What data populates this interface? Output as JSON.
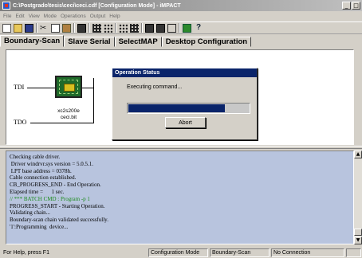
{
  "window": {
    "title": "C:\\Postgrado\\tesis\\ceci\\ceci.cdf [Configuration Mode] - iMPACT",
    "minimize_glyph": "_",
    "maximize_glyph": "□"
  },
  "menu": [
    "File",
    "Edit",
    "View",
    "Mode",
    "Operations",
    "Output",
    "Help"
  ],
  "tabs": [
    "Boundary-Scan",
    "Slave Serial",
    "SelectMAP",
    "Desktop Configuration"
  ],
  "active_tab": "Boundary-Scan",
  "canvas": {
    "tdi_label": "TDI",
    "tdo_label": "TDO",
    "device_name": "xc2s200e",
    "device_file": "ceci.bit",
    "chip_brand": "Xilinx"
  },
  "dialog": {
    "title": "Operation Status",
    "message": "Executing command...",
    "progress": 0.8,
    "abort_label": "Abort"
  },
  "log": [
    {
      "text": "Checking cable driver.",
      "cmd": false
    },
    {
      "text": " Driver windrvr.sys version = 5.0.5.1.",
      "cmd": false
    },
    {
      "text": " LPT base address = 0378h.",
      "cmd": false
    },
    {
      "text": "Cable connection established.",
      "cmd": false
    },
    {
      "text": "CB_PROGRESS_END - End Operation.",
      "cmd": false
    },
    {
      "text": "Elapsed time =      1 sec.",
      "cmd": false
    },
    {
      "text": "// *** BATCH CMD : Program -p 1",
      "cmd": true
    },
    {
      "text": "PROGRESS_START - Starting Operation.",
      "cmd": false
    },
    {
      "text": "Validating chain...",
      "cmd": false
    },
    {
      "text": "Boundary-scan chain validated successfully.",
      "cmd": false
    },
    {
      "text": "'1':Programming  device...",
      "cmd": false
    }
  ],
  "status": {
    "help": "For Help, press F1",
    "mode": "Configuration Mode",
    "scan": "Boundary-Scan",
    "connection": "No Connection"
  },
  "colors": {
    "dialog_titlebar": "#0a246a",
    "progress_fill": "#0a246a",
    "console_bg": "#b8c4de",
    "chip_green": "#1f6a2a",
    "batch_cmd_green": "#1a8a1a"
  }
}
